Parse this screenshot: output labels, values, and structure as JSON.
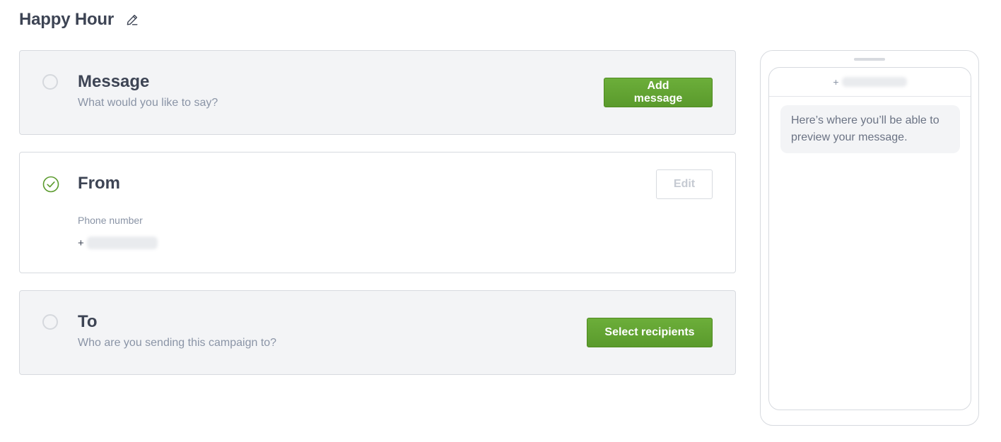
{
  "header": {
    "title": "Happy Hour",
    "edit_icon": "pencil-icon"
  },
  "message_section": {
    "title": "Message",
    "subtitle": "What would you like to say?",
    "button_label": "Add message",
    "status": "incomplete"
  },
  "from_section": {
    "title": "From",
    "button_label": "Edit",
    "status": "complete",
    "status_icon": "check-circle-icon",
    "field_label": "Phone number",
    "phone_prefix": "+"
  },
  "to_section": {
    "title": "To",
    "subtitle": "Who are you sending this campaign to?",
    "button_label": "Select recipients",
    "status": "incomplete"
  },
  "preview": {
    "recipient_prefix": "+",
    "placeholder_message": "Here’s where you’ll be able to preview your message."
  },
  "colors": {
    "primary_green": "#5f9f30",
    "check_green": "#5a9a2c",
    "text_dark": "#3d4454",
    "text_muted": "#8a94a6",
    "card_inactive_bg": "#f3f4f6",
    "border": "#d7dadf"
  }
}
